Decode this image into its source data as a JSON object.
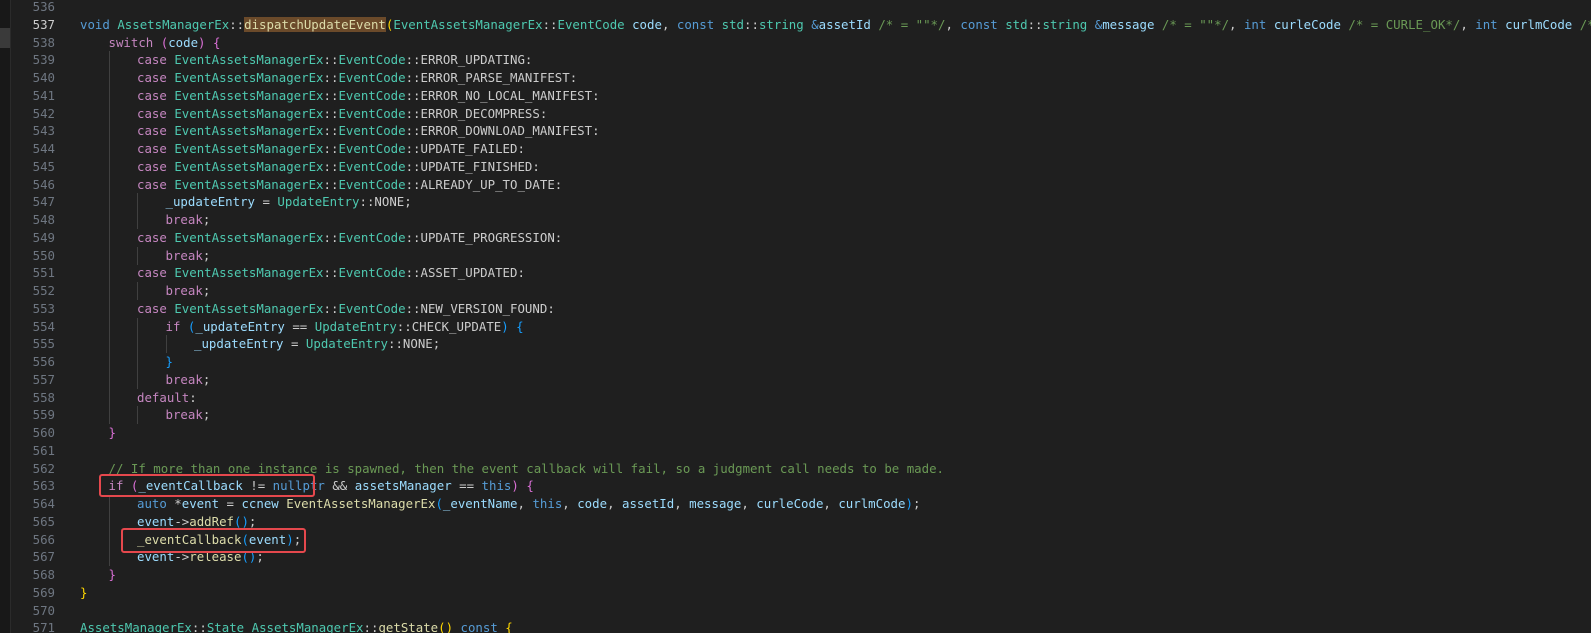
{
  "editor": {
    "lines": [
      {
        "n": "536",
        "indent": 0,
        "tokens": []
      },
      {
        "n": "537",
        "indent": 0,
        "tokens": [
          [
            "kw",
            "void"
          ],
          [
            "pl",
            " "
          ],
          [
            "ty",
            "AssetsManagerEx"
          ],
          [
            "pl",
            "::"
          ],
          [
            "fn hl",
            "dispatchUpdateEvent"
          ],
          [
            "b1",
            "("
          ],
          [
            "ty",
            "EventAssetsManagerEx"
          ],
          [
            "pl",
            "::"
          ],
          [
            "ty",
            "EventCode"
          ],
          [
            "pl",
            " "
          ],
          [
            "var",
            "code"
          ],
          [
            "pl",
            ", "
          ],
          [
            "kw",
            "const"
          ],
          [
            "pl",
            " "
          ],
          [
            "ty",
            "std"
          ],
          [
            "pl",
            "::"
          ],
          [
            "ty",
            "string"
          ],
          [
            "pl",
            " "
          ],
          [
            "kw",
            "&"
          ],
          [
            "var",
            "assetId"
          ],
          [
            "pl",
            " "
          ],
          [
            "cm",
            "/* = \"\"*/"
          ],
          [
            "pl",
            ", "
          ],
          [
            "kw",
            "const"
          ],
          [
            "pl",
            " "
          ],
          [
            "ty",
            "std"
          ],
          [
            "pl",
            "::"
          ],
          [
            "ty",
            "string"
          ],
          [
            "pl",
            " "
          ],
          [
            "kw",
            "&"
          ],
          [
            "var",
            "message"
          ],
          [
            "pl",
            " "
          ],
          [
            "cm",
            "/* = \"\"*/"
          ],
          [
            "pl",
            ", "
          ],
          [
            "kw",
            "int"
          ],
          [
            "pl",
            " "
          ],
          [
            "var",
            "curleCode"
          ],
          [
            "pl",
            " "
          ],
          [
            "cm",
            "/* = CURLE_OK*/"
          ],
          [
            "pl",
            ", "
          ],
          [
            "kw",
            "int"
          ],
          [
            "pl",
            " "
          ],
          [
            "var",
            "curlmCode"
          ],
          [
            "pl",
            " "
          ],
          [
            "cm",
            "/* = CURLM_OK*/"
          ],
          [
            "b1",
            ")"
          ]
        ]
      },
      {
        "n": "538",
        "indent": 1,
        "tokens": [
          [
            "ctl",
            "switch"
          ],
          [
            "pl",
            " "
          ],
          [
            "b2",
            "("
          ],
          [
            "var",
            "code"
          ],
          [
            "b2",
            ")"
          ],
          [
            "pl",
            " "
          ],
          [
            "b2",
            "{"
          ]
        ]
      },
      {
        "n": "539",
        "indent": 2,
        "tokens": [
          [
            "ctl",
            "case"
          ],
          [
            "pl",
            " "
          ],
          [
            "ty",
            "EventAssetsManagerEx"
          ],
          [
            "pl",
            "::"
          ],
          [
            "ty",
            "EventCode"
          ],
          [
            "pl",
            "::ERROR_UPDATING:"
          ]
        ]
      },
      {
        "n": "540",
        "indent": 2,
        "tokens": [
          [
            "ctl",
            "case"
          ],
          [
            "pl",
            " "
          ],
          [
            "ty",
            "EventAssetsManagerEx"
          ],
          [
            "pl",
            "::"
          ],
          [
            "ty",
            "EventCode"
          ],
          [
            "pl",
            "::ERROR_PARSE_MANIFEST:"
          ]
        ]
      },
      {
        "n": "541",
        "indent": 2,
        "tokens": [
          [
            "ctl",
            "case"
          ],
          [
            "pl",
            " "
          ],
          [
            "ty",
            "EventAssetsManagerEx"
          ],
          [
            "pl",
            "::"
          ],
          [
            "ty",
            "EventCode"
          ],
          [
            "pl",
            "::ERROR_NO_LOCAL_MANIFEST:"
          ]
        ]
      },
      {
        "n": "542",
        "indent": 2,
        "tokens": [
          [
            "ctl",
            "case"
          ],
          [
            "pl",
            " "
          ],
          [
            "ty",
            "EventAssetsManagerEx"
          ],
          [
            "pl",
            "::"
          ],
          [
            "ty",
            "EventCode"
          ],
          [
            "pl",
            "::ERROR_DECOMPRESS:"
          ]
        ]
      },
      {
        "n": "543",
        "indent": 2,
        "tokens": [
          [
            "ctl",
            "case"
          ],
          [
            "pl",
            " "
          ],
          [
            "ty",
            "EventAssetsManagerEx"
          ],
          [
            "pl",
            "::"
          ],
          [
            "ty",
            "EventCode"
          ],
          [
            "pl",
            "::ERROR_DOWNLOAD_MANIFEST:"
          ]
        ]
      },
      {
        "n": "544",
        "indent": 2,
        "tokens": [
          [
            "ctl",
            "case"
          ],
          [
            "pl",
            " "
          ],
          [
            "ty",
            "EventAssetsManagerEx"
          ],
          [
            "pl",
            "::"
          ],
          [
            "ty",
            "EventCode"
          ],
          [
            "pl",
            "::UPDATE_FAILED:"
          ]
        ]
      },
      {
        "n": "545",
        "indent": 2,
        "tokens": [
          [
            "ctl",
            "case"
          ],
          [
            "pl",
            " "
          ],
          [
            "ty",
            "EventAssetsManagerEx"
          ],
          [
            "pl",
            "::"
          ],
          [
            "ty",
            "EventCode"
          ],
          [
            "pl",
            "::UPDATE_FINISHED:"
          ]
        ]
      },
      {
        "n": "546",
        "indent": 2,
        "tokens": [
          [
            "ctl",
            "case"
          ],
          [
            "pl",
            " "
          ],
          [
            "ty",
            "EventAssetsManagerEx"
          ],
          [
            "pl",
            "::"
          ],
          [
            "ty",
            "EventCode"
          ],
          [
            "pl",
            "::ALREADY_UP_TO_DATE:"
          ]
        ]
      },
      {
        "n": "547",
        "indent": 3,
        "tokens": [
          [
            "var",
            "_updateEntry"
          ],
          [
            "pl",
            " = "
          ],
          [
            "ty",
            "UpdateEntry"
          ],
          [
            "pl",
            "::NONE;"
          ]
        ]
      },
      {
        "n": "548",
        "indent": 3,
        "tokens": [
          [
            "ctl",
            "break"
          ],
          [
            "pl",
            ";"
          ]
        ]
      },
      {
        "n": "549",
        "indent": 2,
        "tokens": [
          [
            "ctl",
            "case"
          ],
          [
            "pl",
            " "
          ],
          [
            "ty",
            "EventAssetsManagerEx"
          ],
          [
            "pl",
            "::"
          ],
          [
            "ty",
            "EventCode"
          ],
          [
            "pl",
            "::UPDATE_PROGRESSION:"
          ]
        ]
      },
      {
        "n": "550",
        "indent": 3,
        "tokens": [
          [
            "ctl",
            "break"
          ],
          [
            "pl",
            ";"
          ]
        ]
      },
      {
        "n": "551",
        "indent": 2,
        "tokens": [
          [
            "ctl",
            "case"
          ],
          [
            "pl",
            " "
          ],
          [
            "ty",
            "EventAssetsManagerEx"
          ],
          [
            "pl",
            "::"
          ],
          [
            "ty",
            "EventCode"
          ],
          [
            "pl",
            "::ASSET_UPDATED:"
          ]
        ]
      },
      {
        "n": "552",
        "indent": 3,
        "tokens": [
          [
            "ctl",
            "break"
          ],
          [
            "pl",
            ";"
          ]
        ]
      },
      {
        "n": "553",
        "indent": 2,
        "tokens": [
          [
            "ctl",
            "case"
          ],
          [
            "pl",
            " "
          ],
          [
            "ty",
            "EventAssetsManagerEx"
          ],
          [
            "pl",
            "::"
          ],
          [
            "ty",
            "EventCode"
          ],
          [
            "pl",
            "::NEW_VERSION_FOUND:"
          ]
        ]
      },
      {
        "n": "554",
        "indent": 3,
        "tokens": [
          [
            "ctl",
            "if"
          ],
          [
            "pl",
            " "
          ],
          [
            "b3",
            "("
          ],
          [
            "var",
            "_updateEntry"
          ],
          [
            "pl",
            " == "
          ],
          [
            "ty",
            "UpdateEntry"
          ],
          [
            "pl",
            "::CHECK_UPDATE"
          ],
          [
            "b3",
            ")"
          ],
          [
            "pl",
            " "
          ],
          [
            "b3",
            "{"
          ]
        ]
      },
      {
        "n": "555",
        "indent": 4,
        "tokens": [
          [
            "var",
            "_updateEntry"
          ],
          [
            "pl",
            " = "
          ],
          [
            "ty",
            "UpdateEntry"
          ],
          [
            "pl",
            "::NONE;"
          ]
        ]
      },
      {
        "n": "556",
        "indent": 3,
        "tokens": [
          [
            "b3",
            "}"
          ]
        ]
      },
      {
        "n": "557",
        "indent": 3,
        "tokens": [
          [
            "ctl",
            "break"
          ],
          [
            "pl",
            ";"
          ]
        ]
      },
      {
        "n": "558",
        "indent": 2,
        "tokens": [
          [
            "ctl",
            "default"
          ],
          [
            "pl",
            ":"
          ]
        ]
      },
      {
        "n": "559",
        "indent": 3,
        "tokens": [
          [
            "ctl",
            "break"
          ],
          [
            "pl",
            ";"
          ]
        ]
      },
      {
        "n": "560",
        "indent": 1,
        "tokens": [
          [
            "b2",
            "}"
          ]
        ]
      },
      {
        "n": "561",
        "indent": 0,
        "tokens": []
      },
      {
        "n": "562",
        "indent": 1,
        "tokens": [
          [
            "cm",
            "// If more than one instance is spawned, then the event callback will fail, so a judgment call needs to be made."
          ]
        ]
      },
      {
        "n": "563",
        "indent": 1,
        "tokens": [
          [
            "ctl",
            "if"
          ],
          [
            "pl",
            " "
          ],
          [
            "b2",
            "("
          ],
          [
            "var",
            "_eventCallback"
          ],
          [
            "pl",
            " != "
          ],
          [
            "kw",
            "nullptr"
          ],
          [
            "pl",
            " && "
          ],
          [
            "var",
            "assetsManager"
          ],
          [
            "pl",
            " == "
          ],
          [
            "kw",
            "this"
          ],
          [
            "b2",
            ")"
          ],
          [
            "pl",
            " "
          ],
          [
            "b2",
            "{"
          ]
        ]
      },
      {
        "n": "564",
        "indent": 2,
        "tokens": [
          [
            "kw",
            "auto"
          ],
          [
            "pl",
            " *"
          ],
          [
            "var",
            "event"
          ],
          [
            "pl",
            " = "
          ],
          [
            "var",
            "ccnew"
          ],
          [
            "pl",
            " "
          ],
          [
            "fn",
            "EventAssetsManagerEx"
          ],
          [
            "b3",
            "("
          ],
          [
            "var",
            "_eventName"
          ],
          [
            "pl",
            ", "
          ],
          [
            "kw",
            "this"
          ],
          [
            "pl",
            ", "
          ],
          [
            "var",
            "code"
          ],
          [
            "pl",
            ", "
          ],
          [
            "var",
            "assetId"
          ],
          [
            "pl",
            ", "
          ],
          [
            "var",
            "message"
          ],
          [
            "pl",
            ", "
          ],
          [
            "var",
            "curleCode"
          ],
          [
            "pl",
            ", "
          ],
          [
            "var",
            "curlmCode"
          ],
          [
            "b3",
            ")"
          ],
          [
            "pl",
            ";"
          ]
        ]
      },
      {
        "n": "565",
        "indent": 2,
        "tokens": [
          [
            "var",
            "event"
          ],
          [
            "pl",
            "->"
          ],
          [
            "fn",
            "addRef"
          ],
          [
            "b3",
            "()"
          ],
          [
            "pl",
            ";"
          ]
        ]
      },
      {
        "n": "566",
        "indent": 2,
        "tokens": [
          [
            "fn",
            "_eventCallback"
          ],
          [
            "b3",
            "("
          ],
          [
            "var",
            "event"
          ],
          [
            "b3",
            ")"
          ],
          [
            "pl",
            ";"
          ]
        ]
      },
      {
        "n": "567",
        "indent": 2,
        "tokens": [
          [
            "var",
            "event"
          ],
          [
            "pl",
            "->"
          ],
          [
            "fn",
            "release"
          ],
          [
            "b3",
            "()"
          ],
          [
            "pl",
            ";"
          ]
        ]
      },
      {
        "n": "568",
        "indent": 1,
        "tokens": [
          [
            "b2",
            "}"
          ]
        ]
      },
      {
        "n": "569",
        "indent": 0,
        "tokens": [
          [
            "b1",
            "}"
          ]
        ]
      },
      {
        "n": "570",
        "indent": 0,
        "tokens": []
      },
      {
        "n": "571",
        "indent": 0,
        "tokens": [
          [
            "ty",
            "AssetsManagerEx"
          ],
          [
            "pl",
            "::"
          ],
          [
            "ty",
            "State"
          ],
          [
            "pl",
            " "
          ],
          [
            "ty",
            "AssetsManagerEx"
          ],
          [
            "pl",
            "::"
          ],
          [
            "fn",
            "getState"
          ],
          [
            "b1",
            "()"
          ],
          [
            "pl",
            " "
          ],
          [
            "kw",
            "const"
          ],
          [
            "pl",
            " "
          ],
          [
            "b1",
            "{"
          ]
        ]
      }
    ]
  }
}
